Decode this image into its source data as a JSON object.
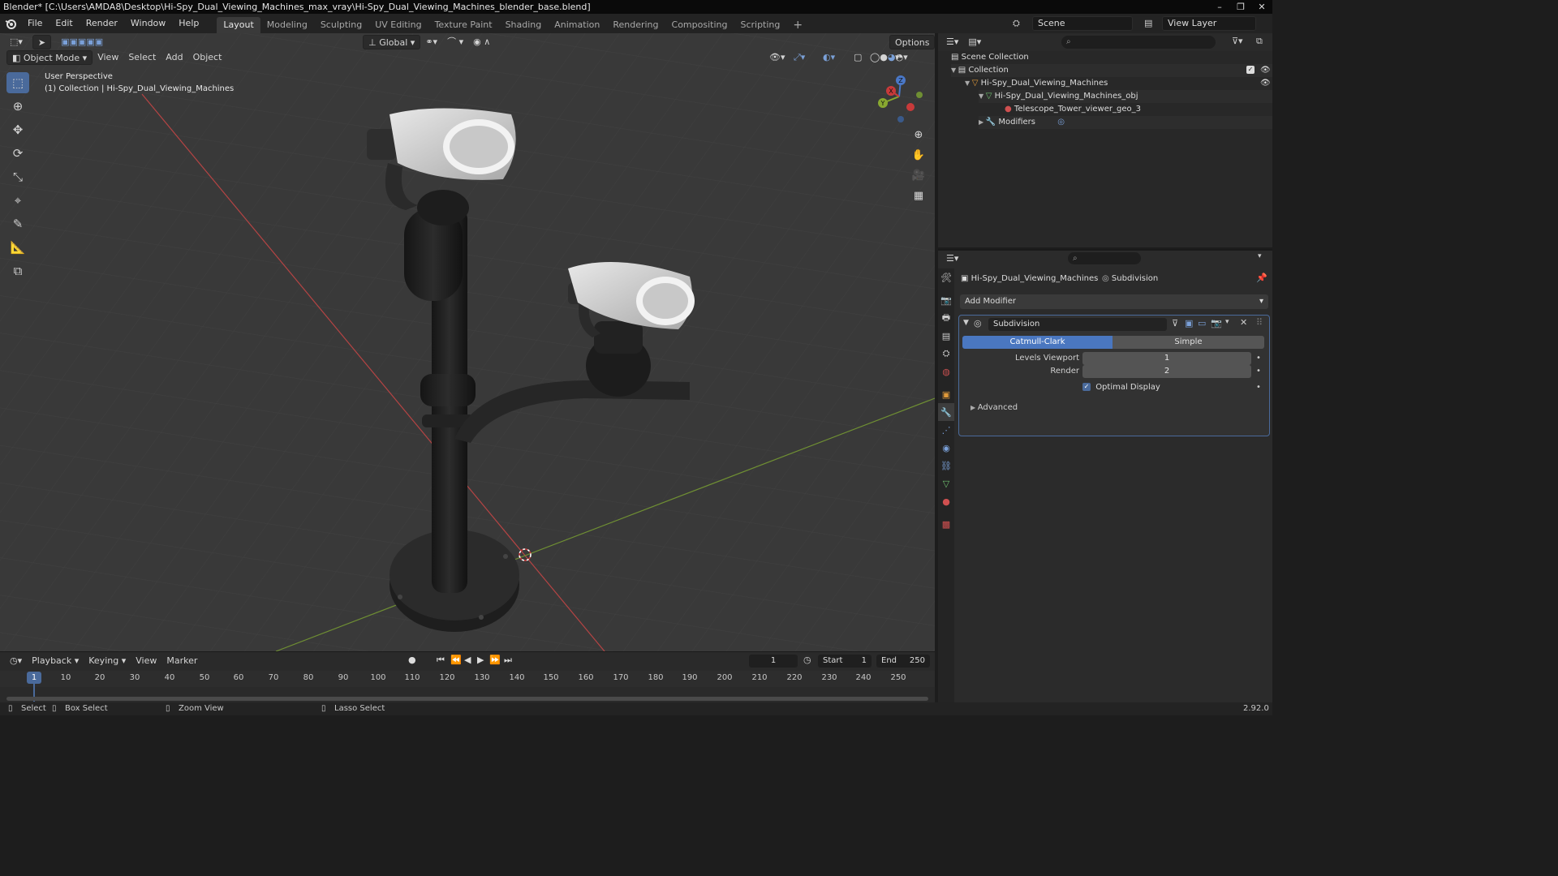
{
  "window": {
    "title": "Blender* [C:\\Users\\AMDA8\\Desktop\\Hi-Spy_Dual_Viewing_Machines_max_vray\\Hi-Spy_Dual_Viewing_Machines_blender_base.blend]",
    "controls": [
      "–",
      "❐",
      "✕"
    ]
  },
  "menu": [
    "File",
    "Edit",
    "Render",
    "Window",
    "Help"
  ],
  "workspaces": [
    "Layout",
    "Modeling",
    "Sculpting",
    "UV Editing",
    "Texture Paint",
    "Shading",
    "Animation",
    "Rendering",
    "Compositing",
    "Scripting"
  ],
  "active_workspace": "Layout",
  "add_workspace": "+",
  "scene": "Scene",
  "view_layer": "View Layer",
  "viewport": {
    "mode": "Object Mode",
    "menus": [
      "View",
      "Select",
      "Add",
      "Object"
    ],
    "orientation": "Global",
    "options": "Options",
    "perspective": "User Perspective",
    "collection_info": "(1) Collection | Hi-Spy_Dual_Viewing_Machines",
    "gizmo": {
      "x": "X",
      "y": "Y",
      "z": "Z"
    },
    "colors": {
      "background": "#393939",
      "x_axis": "#c04848",
      "y_axis": "#7a9a3a",
      "active_tool": "#4a6a9b"
    }
  },
  "timeline": {
    "menus": [
      "Playback",
      "Keying",
      "View",
      "Marker"
    ],
    "current_frame": "1",
    "start_label": "Start",
    "start": "1",
    "end_label": "End",
    "end": "250",
    "ticks": [
      "10",
      "20",
      "30",
      "40",
      "50",
      "60",
      "70",
      "80",
      "90",
      "100",
      "110",
      "120",
      "130",
      "140",
      "150",
      "160",
      "170",
      "180",
      "190",
      "200",
      "210",
      "220",
      "230",
      "240",
      "250"
    ],
    "playhead": "1"
  },
  "statusbar": {
    "select": "Select",
    "box_select": "Box Select",
    "zoom_view": "Zoom View",
    "lasso_select": "Lasso Select",
    "version": "2.92.0"
  },
  "outliner": {
    "scene_collection": "Scene Collection",
    "collection": "Collection",
    "object": "Hi-Spy_Dual_Viewing_Machines",
    "mesh": "Hi-Spy_Dual_Viewing_Machines_obj",
    "material": "Telescope_Tower_viewer_geo_3",
    "modifiers": "Modifiers"
  },
  "properties": {
    "breadcrumb_object": "Hi-Spy_Dual_Viewing_Machines",
    "breadcrumb_modifier": "Subdivision",
    "add_modifier": "Add Modifier",
    "modifier": {
      "name": "Subdivision",
      "type_catmull": "Catmull-Clark",
      "type_simple": "Simple",
      "levels_viewport_label": "Levels Viewport",
      "levels_viewport": "1",
      "render_label": "Render",
      "render": "2",
      "optimal_display": "Optimal Display",
      "advanced": "Advanced"
    }
  }
}
